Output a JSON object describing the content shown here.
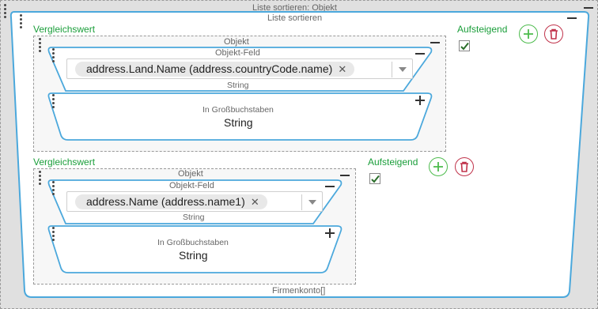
{
  "outer": {
    "caption": "Liste sortieren: Objekt"
  },
  "list": {
    "caption": "Liste sortieren",
    "footer": "Firmenkonto[]"
  },
  "entries": [
    {
      "compare_label": "Vergleichswert",
      "object_caption": "Objekt",
      "field_caption": "Objekt-Feld",
      "field_value": "address.Land.Name (address.countryCode.name)",
      "field_type": "String",
      "upper_caption": "In Großbuchstaben",
      "upper_type": "String",
      "ascending_label": "Aufsteigend"
    },
    {
      "compare_label": "Vergleichswert",
      "object_caption": "Objekt",
      "field_caption": "Objekt-Feld",
      "field_value": "address.Name (address.name1)",
      "field_type": "String",
      "upper_caption": "In Großbuchstaben",
      "upper_type": "String",
      "ascending_label": "Aufsteigend"
    }
  ],
  "icons": {
    "drag": "drag-handle-icon",
    "collapse": "minus-icon",
    "expand": "plus-icon",
    "remove_chip": "close-icon",
    "dropdown": "chevron-down-icon",
    "add": "add-icon",
    "delete": "trash-icon",
    "check": "checkmark-icon"
  },
  "colors": {
    "accent_blue": "#4ba8dc",
    "label_green": "#1a9e3a",
    "add_green": "#4cbb4c",
    "delete_red": "#c0324a"
  }
}
